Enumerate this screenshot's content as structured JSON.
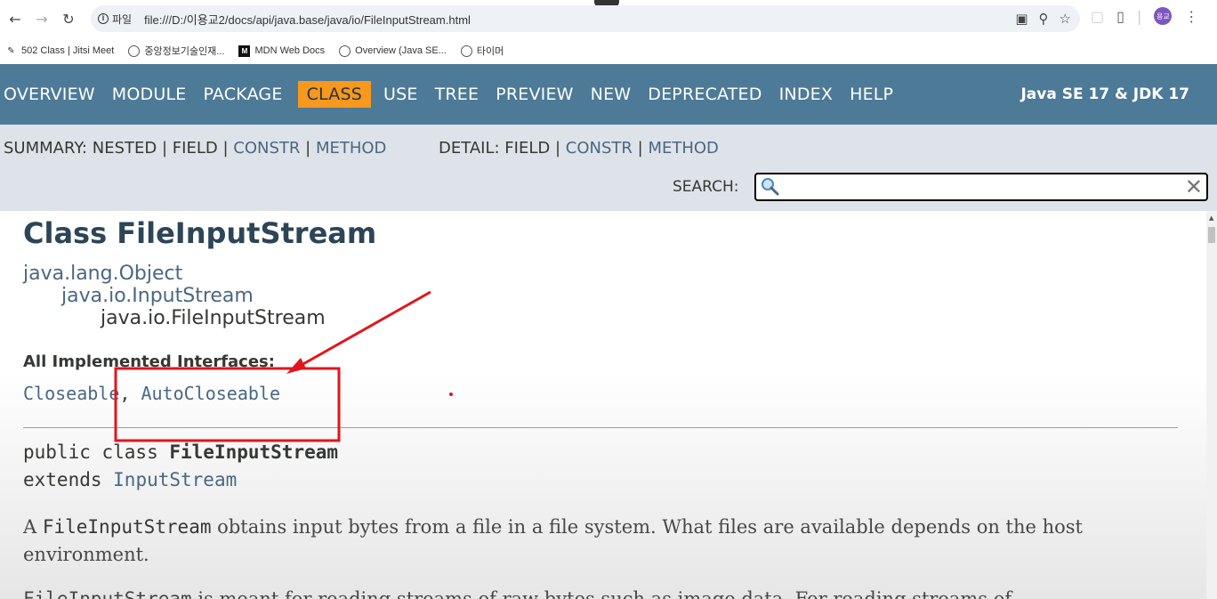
{
  "browser": {
    "site_info_label": "파일",
    "url": "file:///D:/이용교2/docs/api/java.base/java/io/FileInputStream.html",
    "profile_initials": "용교"
  },
  "bookmarks": [
    {
      "label": "502 Class | Jitsi Meet",
      "icon": "jitsi-icon"
    },
    {
      "label": "중앙정보기술인재...",
      "icon": "globe-icon"
    },
    {
      "label": "MDN Web Docs",
      "icon": "mdn-icon"
    },
    {
      "label": "Overview (Java SE...",
      "icon": "globe-icon"
    },
    {
      "label": "타이머",
      "icon": "globe-icon"
    }
  ],
  "topnav": {
    "items": [
      "OVERVIEW",
      "MODULE",
      "PACKAGE",
      "CLASS",
      "USE",
      "TREE",
      "PREVIEW",
      "NEW",
      "DEPRECATED",
      "INDEX",
      "HELP"
    ],
    "active": "CLASS",
    "brand": "Java SE 17 & JDK 17"
  },
  "subnav": {
    "summary_label": "SUMMARY:",
    "summary_nested": "NESTED",
    "summary_field": "FIELD",
    "summary_constr": "CONSTR",
    "summary_method": "METHOD",
    "detail_label": "DETAIL:",
    "detail_field": "FIELD",
    "detail_constr": "CONSTR",
    "detail_method": "METHOD",
    "sep": "|",
    "search_label": "SEARCH:"
  },
  "content": {
    "title": "Class FileInputStream",
    "inheritance": [
      "java.lang.Object",
      "java.io.InputStream",
      "java.io.FileInputStream"
    ],
    "impl_label": "All Implemented Interfaces:",
    "impl_interfaces": [
      "Closeable",
      "AutoCloseable"
    ],
    "impl_comma": ",",
    "sig_line1_prefix": "public class ",
    "sig_line1_name": "FileInputStream",
    "sig_line2_prefix": "extends ",
    "sig_line2_super": "InputStream",
    "desc_code": "FileInputStream",
    "desc_text": " obtains input bytes from a file in a file system. What files are available depends on the host environment.",
    "desc_prefix": "A ",
    "desc2_code": "FileInputStream",
    "desc2_text": " is meant for reading streams of raw bytes such as image data. For reading streams of"
  },
  "annotation_color": "#e0161c"
}
